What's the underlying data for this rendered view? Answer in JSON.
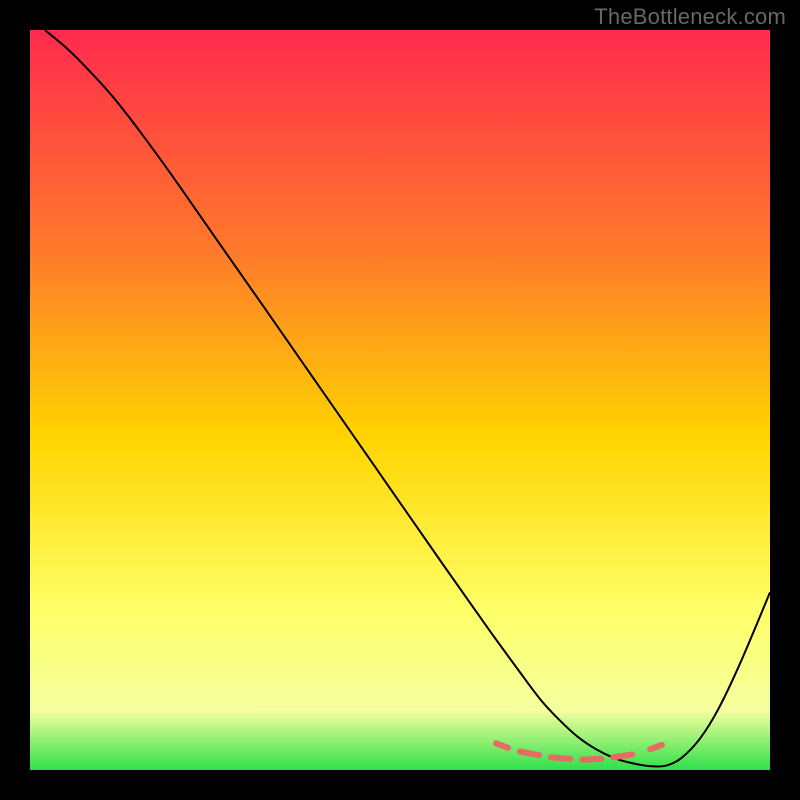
{
  "watermark": "TheBottleneck.com",
  "chart_data": {
    "type": "line",
    "title": "",
    "xlabel": "",
    "ylabel": "",
    "xlim": [
      0,
      100
    ],
    "ylim": [
      0,
      100
    ],
    "gradient": {
      "top": "#ff2a4d",
      "upper_mid": "#ff7a2a",
      "mid": "#ffd400",
      "lower_mid": "#ffff66",
      "lower": "#f4ff9e",
      "bottom": "#2fe04a"
    },
    "series": [
      {
        "name": "curve",
        "stroke": "#000000",
        "stroke_width": 2,
        "x": [
          2,
          5,
          8,
          12,
          18,
          25,
          32,
          40,
          48,
          56,
          62,
          66,
          69,
          71.5,
          74,
          76.5,
          79,
          81.5,
          84,
          86,
          88,
          90.5,
          93,
          96,
          100
        ],
        "y": [
          100,
          97.5,
          94.5,
          90,
          82,
          72,
          62,
          50.5,
          39,
          27.5,
          19,
          13.5,
          9.5,
          6.8,
          4.5,
          2.8,
          1.6,
          0.9,
          0.5,
          0.6,
          1.6,
          4.2,
          8.2,
          14.5,
          24
        ]
      }
    ],
    "markers": {
      "name": "dotted-band",
      "stroke": "#e86a62",
      "stroke_width": 6,
      "segments": [
        {
          "x0": 63.0,
          "y0": 3.6,
          "x1": 64.6,
          "y1": 3.0
        },
        {
          "x0": 66.2,
          "y0": 2.5,
          "x1": 68.8,
          "y1": 2.0
        },
        {
          "x0": 70.4,
          "y0": 1.7,
          "x1": 73.0,
          "y1": 1.5
        },
        {
          "x0": 74.6,
          "y0": 1.4,
          "x1": 77.2,
          "y1": 1.5
        },
        {
          "x0": 78.8,
          "y0": 1.7,
          "x1": 81.4,
          "y1": 2.1
        },
        {
          "x0": 83.8,
          "y0": 2.8,
          "x1": 85.4,
          "y1": 3.4
        }
      ]
    }
  }
}
